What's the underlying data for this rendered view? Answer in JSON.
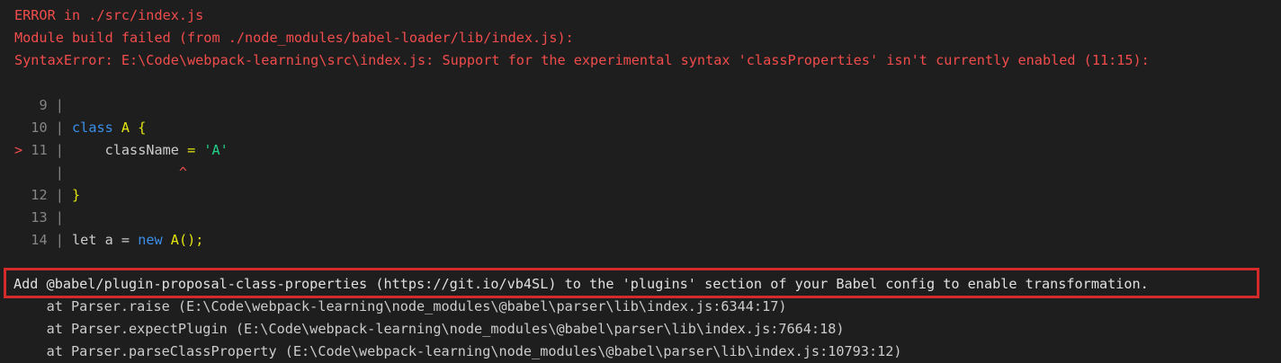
{
  "error": {
    "header": "ERROR in ./src/index.js",
    "module_failed": "Module build failed (from ./node_modules/babel-loader/lib/index.js):",
    "syntax_error": "SyntaxError: E:\\Code\\webpack-learning\\src\\index.js: Support for the experimental syntax 'classProperties' isn't currently enabled (11:15):"
  },
  "code_frame": {
    "line9_num": "9",
    "line10_num": "10",
    "line10_kw": "class",
    "line10_name": "A",
    "line10_brace": "{",
    "marker": ">",
    "line11_num": "11",
    "line11_ident": "className",
    "line11_eq": "=",
    "line11_str": "'A'",
    "caret": "^",
    "line12_num": "12",
    "line12_code": "}",
    "line13_num": "13",
    "line14_num": "14",
    "line14_let": "let a =",
    "line14_new": "new",
    "line14_ctor": "A",
    "line14_tail": "();"
  },
  "advice": "Add @babel/plugin-proposal-class-properties (https://git.io/vb4SL) to the 'plugins' section of your Babel config to enable transformation.",
  "stack": [
    "    at Parser.raise (E:\\Code\\webpack-learning\\node_modules\\@babel\\parser\\lib\\index.js:6344:17)",
    "    at Parser.expectPlugin (E:\\Code\\webpack-learning\\node_modules\\@babel\\parser\\lib\\index.js:7664:18)",
    "    at Parser.parseClassProperty (E:\\Code\\webpack-learning\\node_modules\\@babel\\parser\\lib\\index.js:10793:12)"
  ],
  "colors": {
    "background": "#1e1e1e",
    "error": "#f14c4c",
    "keyword": "#3b8eea",
    "identifier": "#e5e510",
    "string": "#23d18b",
    "highlight_box": "#d42a2a"
  }
}
